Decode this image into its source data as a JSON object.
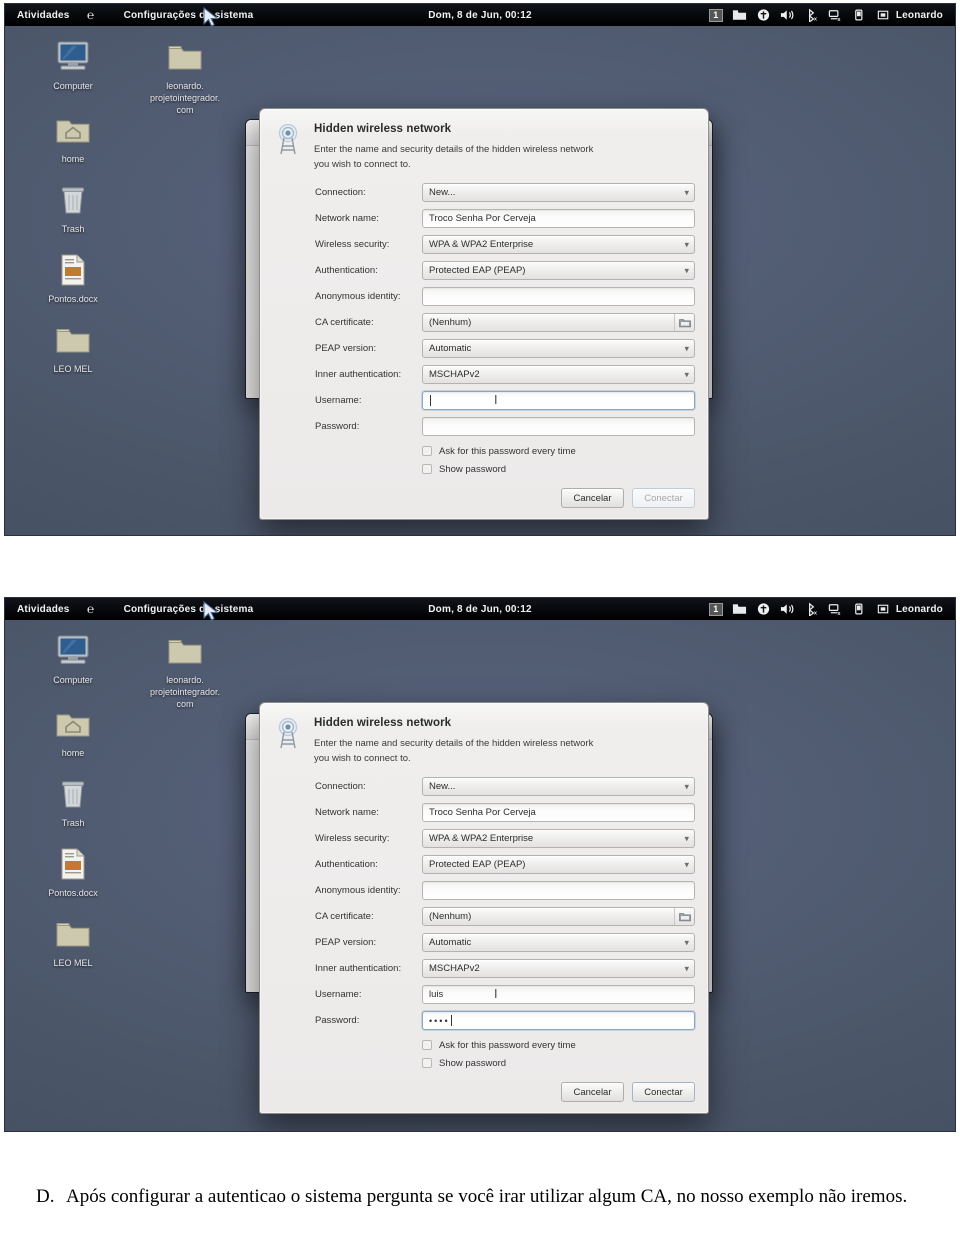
{
  "topbar": {
    "activities": "Atividades",
    "app_icon": "firefox-icon",
    "app_title": "Configurações do sistema",
    "clock": "Dom,  8 de Jun, 00:12",
    "workspace": "1",
    "user": "Leonardo",
    "indicators": [
      {
        "name": "workspace-badge",
        "label": "1"
      },
      {
        "name": "folder-icon",
        "label": ""
      },
      {
        "name": "accessibility-icon",
        "label": ""
      },
      {
        "name": "volume-icon",
        "label": ""
      },
      {
        "name": "bluetooth-off-icon",
        "label": ""
      },
      {
        "name": "network-disconnected-icon",
        "label": ""
      },
      {
        "name": "battery-icon",
        "label": ""
      }
    ]
  },
  "desktop_icons": [
    {
      "name": "computer",
      "label": "Computer",
      "icon": "computer-icon"
    },
    {
      "name": "leonardo-folder",
      "label": "leonardo.\nprojetointegrador.\ncom",
      "icon": "folder-icon"
    },
    {
      "name": "home",
      "label": "home",
      "icon": "home-folder-icon"
    },
    {
      "name": "trash",
      "label": "Trash",
      "icon": "trash-icon"
    },
    {
      "name": "pontos-docx",
      "label": "Pontos.docx",
      "icon": "document-icon"
    },
    {
      "name": "leo-mel",
      "label": "LEO MEL",
      "icon": "folder-icon"
    }
  ],
  "dialog": {
    "title": "Hidden wireless network",
    "description": "Enter the name and security details of the hidden wireless network you wish to connect to.",
    "icon": "wireless-tower-icon",
    "fields": [
      {
        "label": "Connection:",
        "type": "combo",
        "value": "New..."
      },
      {
        "label": "Network name:",
        "type": "text",
        "value": "Troco Senha Por Cerveja"
      },
      {
        "label": "Wireless security:",
        "type": "combo",
        "value": "WPA & WPA2 Enterprise"
      },
      {
        "label": "Authentication:",
        "type": "combo",
        "value": "Protected EAP (PEAP)"
      },
      {
        "label": "Anonymous identity:",
        "type": "text",
        "value": ""
      },
      {
        "label": "CA certificate:",
        "type": "file",
        "value": "(Nenhum)"
      },
      {
        "label": "PEAP version:",
        "type": "combo",
        "value": "Automatic"
      },
      {
        "label": "Inner authentication:",
        "type": "combo",
        "value": "MSCHAPv2"
      }
    ],
    "username_label": "Username:",
    "password_label": "Password:",
    "checkboxes": [
      {
        "label": "Ask for this password every time",
        "checked": false
      },
      {
        "label": "Show password",
        "checked": false
      }
    ],
    "cancel_label": "Cancelar",
    "connect_label": "Conectar"
  },
  "shot1": {
    "username_value": "",
    "password_value": "",
    "connect_enabled": false
  },
  "shot2": {
    "username_value": "luis",
    "password_value": "••••",
    "connect_enabled": true
  },
  "caption": {
    "marker": "D.",
    "text": "Após configurar a autenticao o sistema pergunta se você irar utilizar algum CA, no nosso exemplo não iremos."
  },
  "colors": {
    "desktop": "#4e5a70",
    "topbar": "#050709",
    "dialog_bg": "#ecebe9",
    "accent_focus": "#8ba6bd"
  }
}
